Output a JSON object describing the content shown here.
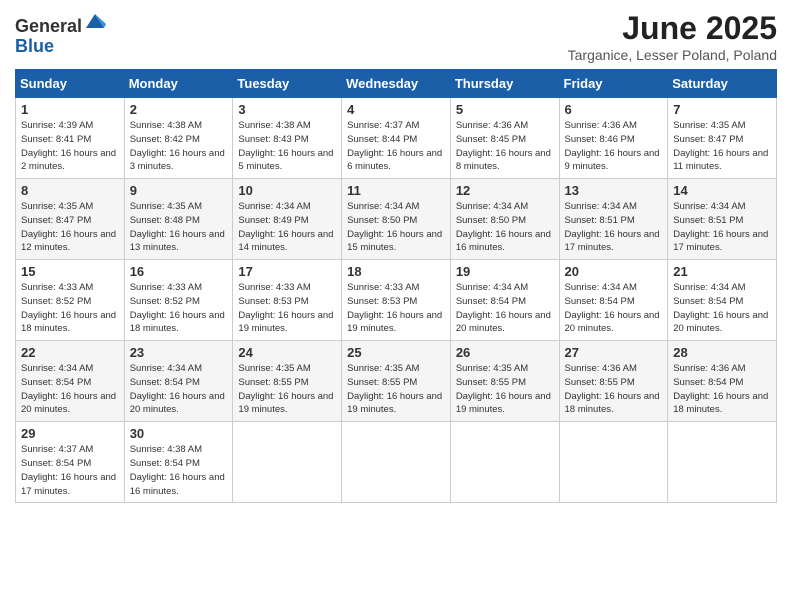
{
  "header": {
    "logo_general": "General",
    "logo_blue": "Blue",
    "month_title": "June 2025",
    "location": "Targanice, Lesser Poland, Poland"
  },
  "weekdays": [
    "Sunday",
    "Monday",
    "Tuesday",
    "Wednesday",
    "Thursday",
    "Friday",
    "Saturday"
  ],
  "weeks": [
    [
      {
        "day": "1",
        "sunrise": "Sunrise: 4:39 AM",
        "sunset": "Sunset: 8:41 PM",
        "daylight": "Daylight: 16 hours and 2 minutes."
      },
      {
        "day": "2",
        "sunrise": "Sunrise: 4:38 AM",
        "sunset": "Sunset: 8:42 PM",
        "daylight": "Daylight: 16 hours and 3 minutes."
      },
      {
        "day": "3",
        "sunrise": "Sunrise: 4:38 AM",
        "sunset": "Sunset: 8:43 PM",
        "daylight": "Daylight: 16 hours and 5 minutes."
      },
      {
        "day": "4",
        "sunrise": "Sunrise: 4:37 AM",
        "sunset": "Sunset: 8:44 PM",
        "daylight": "Daylight: 16 hours and 6 minutes."
      },
      {
        "day": "5",
        "sunrise": "Sunrise: 4:36 AM",
        "sunset": "Sunset: 8:45 PM",
        "daylight": "Daylight: 16 hours and 8 minutes."
      },
      {
        "day": "6",
        "sunrise": "Sunrise: 4:36 AM",
        "sunset": "Sunset: 8:46 PM",
        "daylight": "Daylight: 16 hours and 9 minutes."
      },
      {
        "day": "7",
        "sunrise": "Sunrise: 4:35 AM",
        "sunset": "Sunset: 8:47 PM",
        "daylight": "Daylight: 16 hours and 11 minutes."
      }
    ],
    [
      {
        "day": "8",
        "sunrise": "Sunrise: 4:35 AM",
        "sunset": "Sunset: 8:47 PM",
        "daylight": "Daylight: 16 hours and 12 minutes."
      },
      {
        "day": "9",
        "sunrise": "Sunrise: 4:35 AM",
        "sunset": "Sunset: 8:48 PM",
        "daylight": "Daylight: 16 hours and 13 minutes."
      },
      {
        "day": "10",
        "sunrise": "Sunrise: 4:34 AM",
        "sunset": "Sunset: 8:49 PM",
        "daylight": "Daylight: 16 hours and 14 minutes."
      },
      {
        "day": "11",
        "sunrise": "Sunrise: 4:34 AM",
        "sunset": "Sunset: 8:50 PM",
        "daylight": "Daylight: 16 hours and 15 minutes."
      },
      {
        "day": "12",
        "sunrise": "Sunrise: 4:34 AM",
        "sunset": "Sunset: 8:50 PM",
        "daylight": "Daylight: 16 hours and 16 minutes."
      },
      {
        "day": "13",
        "sunrise": "Sunrise: 4:34 AM",
        "sunset": "Sunset: 8:51 PM",
        "daylight": "Daylight: 16 hours and 17 minutes."
      },
      {
        "day": "14",
        "sunrise": "Sunrise: 4:34 AM",
        "sunset": "Sunset: 8:51 PM",
        "daylight": "Daylight: 16 hours and 17 minutes."
      }
    ],
    [
      {
        "day": "15",
        "sunrise": "Sunrise: 4:33 AM",
        "sunset": "Sunset: 8:52 PM",
        "daylight": "Daylight: 16 hours and 18 minutes."
      },
      {
        "day": "16",
        "sunrise": "Sunrise: 4:33 AM",
        "sunset": "Sunset: 8:52 PM",
        "daylight": "Daylight: 16 hours and 18 minutes."
      },
      {
        "day": "17",
        "sunrise": "Sunrise: 4:33 AM",
        "sunset": "Sunset: 8:53 PM",
        "daylight": "Daylight: 16 hours and 19 minutes."
      },
      {
        "day": "18",
        "sunrise": "Sunrise: 4:33 AM",
        "sunset": "Sunset: 8:53 PM",
        "daylight": "Daylight: 16 hours and 19 minutes."
      },
      {
        "day": "19",
        "sunrise": "Sunrise: 4:34 AM",
        "sunset": "Sunset: 8:54 PM",
        "daylight": "Daylight: 16 hours and 20 minutes."
      },
      {
        "day": "20",
        "sunrise": "Sunrise: 4:34 AM",
        "sunset": "Sunset: 8:54 PM",
        "daylight": "Daylight: 16 hours and 20 minutes."
      },
      {
        "day": "21",
        "sunrise": "Sunrise: 4:34 AM",
        "sunset": "Sunset: 8:54 PM",
        "daylight": "Daylight: 16 hours and 20 minutes."
      }
    ],
    [
      {
        "day": "22",
        "sunrise": "Sunrise: 4:34 AM",
        "sunset": "Sunset: 8:54 PM",
        "daylight": "Daylight: 16 hours and 20 minutes."
      },
      {
        "day": "23",
        "sunrise": "Sunrise: 4:34 AM",
        "sunset": "Sunset: 8:54 PM",
        "daylight": "Daylight: 16 hours and 20 minutes."
      },
      {
        "day": "24",
        "sunrise": "Sunrise: 4:35 AM",
        "sunset": "Sunset: 8:55 PM",
        "daylight": "Daylight: 16 hours and 19 minutes."
      },
      {
        "day": "25",
        "sunrise": "Sunrise: 4:35 AM",
        "sunset": "Sunset: 8:55 PM",
        "daylight": "Daylight: 16 hours and 19 minutes."
      },
      {
        "day": "26",
        "sunrise": "Sunrise: 4:35 AM",
        "sunset": "Sunset: 8:55 PM",
        "daylight": "Daylight: 16 hours and 19 minutes."
      },
      {
        "day": "27",
        "sunrise": "Sunrise: 4:36 AM",
        "sunset": "Sunset: 8:55 PM",
        "daylight": "Daylight: 16 hours and 18 minutes."
      },
      {
        "day": "28",
        "sunrise": "Sunrise: 4:36 AM",
        "sunset": "Sunset: 8:54 PM",
        "daylight": "Daylight: 16 hours and 18 minutes."
      }
    ],
    [
      {
        "day": "29",
        "sunrise": "Sunrise: 4:37 AM",
        "sunset": "Sunset: 8:54 PM",
        "daylight": "Daylight: 16 hours and 17 minutes."
      },
      {
        "day": "30",
        "sunrise": "Sunrise: 4:38 AM",
        "sunset": "Sunset: 8:54 PM",
        "daylight": "Daylight: 16 hours and 16 minutes."
      },
      null,
      null,
      null,
      null,
      null
    ]
  ]
}
